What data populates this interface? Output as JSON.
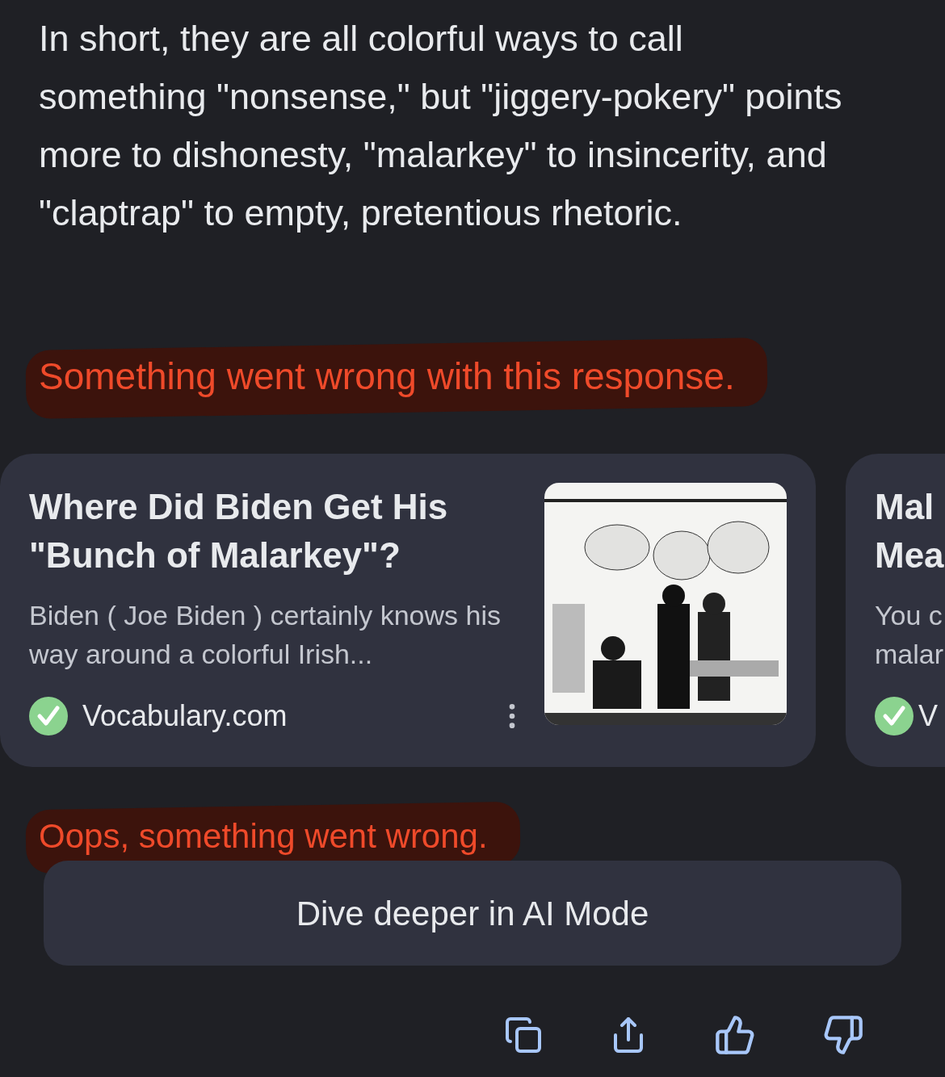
{
  "summary": "In short, they are all colorful ways to call something \"nonsense,\" but \"jiggery-pokery\" points more to dishonesty, \"malarkey\" to insincerity, and \"claptrap\" to empty, pretentious rhetoric.",
  "error_top": "Something went wrong with this response.",
  "cards": [
    {
      "title": "Where Did Biden Get His \"Bunch of Malarkey\"?",
      "snippet": "Biden ( Joe Biden ) certainly knows his way around a colorful Irish...",
      "source": "Vocabulary.com"
    },
    {
      "title": "Mal\nMea",
      "snippet": "You c\nmalar",
      "source": "V"
    }
  ],
  "error_bottom": "Oops, something went wrong.",
  "ai_mode_button": "Dive deeper in AI Mode"
}
